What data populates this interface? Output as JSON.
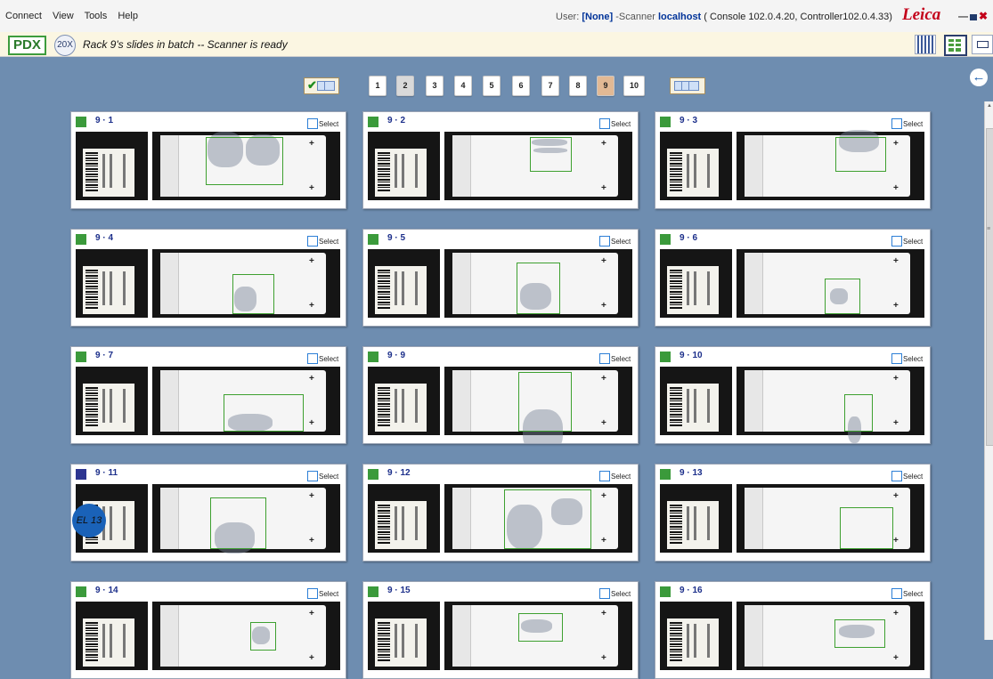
{
  "menu": [
    "Connect",
    "View",
    "Tools",
    "Help"
  ],
  "header": {
    "user_label": "User:",
    "user_value": "[None]",
    "scanner_label": "-Scanner",
    "scanner_value": "localhost",
    "console_info": "( Console 102.0.4.20,",
    "controller_info": "Controller102.0.4.33)",
    "brand": "Leica",
    "win_min": "—",
    "win_close": "✖"
  },
  "status": {
    "mode": "PDX",
    "magnification": "20X",
    "message": "Rack 9's slides in batch -- Scanner is ready"
  },
  "pager": {
    "pages": [
      "1",
      "2",
      "3",
      "4",
      "5",
      "6",
      "7",
      "8",
      "9",
      "10"
    ],
    "visited_page": "2",
    "current_page": "9",
    "check_glyph": "✔"
  },
  "back_glyph": "←",
  "select_label": "Select",
  "colors": {
    "status_green": "#3b9a3b",
    "status_blue": "#2d3590",
    "roi_green": "#3ea030",
    "background": "#6e8db0"
  },
  "cards": [
    {
      "id": "9 · 1",
      "status": "green"
    },
    {
      "id": "9 · 2",
      "status": "green"
    },
    {
      "id": "9 · 3",
      "status": "green"
    },
    {
      "id": "9 · 4",
      "status": "green"
    },
    {
      "id": "9 · 5",
      "status": "green"
    },
    {
      "id": "9 · 6",
      "status": "green"
    },
    {
      "id": "9 · 7",
      "status": "green"
    },
    {
      "id": "9 · 9",
      "status": "green"
    },
    {
      "id": "9 · 10",
      "status": "green"
    },
    {
      "id": "9 · 11",
      "status": "blue",
      "sticker_text": "EL 13"
    },
    {
      "id": "9 · 12",
      "status": "green"
    },
    {
      "id": "9 · 13",
      "status": "green"
    },
    {
      "id": "9 · 14",
      "status": "green"
    },
    {
      "id": "9 · 15",
      "status": "green"
    },
    {
      "id": "9 · 16",
      "status": "green"
    }
  ]
}
